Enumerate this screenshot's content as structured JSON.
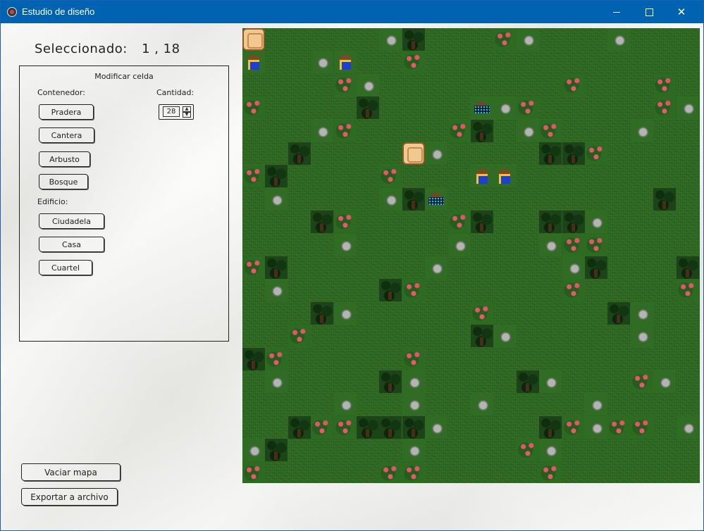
{
  "window": {
    "title": "Estudio de diseño",
    "controls": {
      "minimize": "—",
      "maximize": "□",
      "close": "✕"
    }
  },
  "selection": {
    "label": "Seleccionado:",
    "value": "1 , 18"
  },
  "panel": {
    "title": "Modificar celda",
    "container_label": "Contenedor:",
    "quantity_label": "Cantidad:",
    "quantity_value": "28",
    "container_buttons": [
      "Pradera",
      "Cantera",
      "Arbusto",
      "Bosque"
    ],
    "building_label": "Edificio:",
    "building_buttons": [
      "Ciudadela",
      "Casa",
      "Cuartel"
    ]
  },
  "actions": {
    "clear_map": "Vaciar mapa",
    "export": "Exportar a archivo"
  },
  "colors": {
    "titlebar": "#0063b1",
    "grass": "#316c24",
    "forest": "#1c4418",
    "water": "#4f8a93"
  },
  "map": {
    "tile_types": [
      "grass",
      "forest",
      "flower",
      "rock",
      "water",
      "house",
      "barracks",
      "citadel"
    ],
    "rows": [
      "KGGGGGRFGGGLRGGGRGGGGGGGGGRGGK",
      "HGGRHGGLGGGGGGGGGGGGLFGGGWGGGGG",
      "GGGGLRGGGGGGGGLGGGLGGGGGLRGGGGG",
      "LGGGGFGGGGCRLGGGGGLRGGGGGGGGGGG",
      "GGGRLGGGGLFGRLGGGRGGGGGGRFGGGFR",
      "GGFGGGGKRGGGGFFLGGGGGGGGLGGGGGL",
      "LFGGGGLGGGHHGGGGGGGGGRLGGGGGRLG",
      "GRGGGGRFCGGGGGGGGGFGGGGGGGGFGGG",
      "GGGFLGGGGLFGGFFRGGGGGGGFLGGGGRF",
      "GGGGRGGGGRGGGRLLGGGGGGGGGGGGGGL",
      "LFGGGGGGRGGGGGRFGGGFGRGGGGRFGGG",
      "GRGGGGFLGGGGGGLGGGGLGGGGGGLGGGG",
      "GGGFRGGGGGLGGGGGFRGGGGLGGGGGGGLF",
      "GGLGGGGGGGFRGGGGGRGGGGGRFGGGGGGG",
      "FLGGGGGLGGGGGGGGGGGGGGFGGGLFGGGG",
      "GRGGGGFRGGGGFRGGGLRGGGGGGGGRGGGG",
      "GGGGRGGRGGRGGGGRGGGGGLFGGGGGRGG",
      "GGFLLFFFRGGGGFLRLLGRGGGGGGGGGLF",
      "RFGGGGGRGGGGLRGGGGGGGGGGGLRGGGG",
      "LGGGGGLLGGGGGLGGGGGGGGGGFGGGGGG"
    ]
  }
}
